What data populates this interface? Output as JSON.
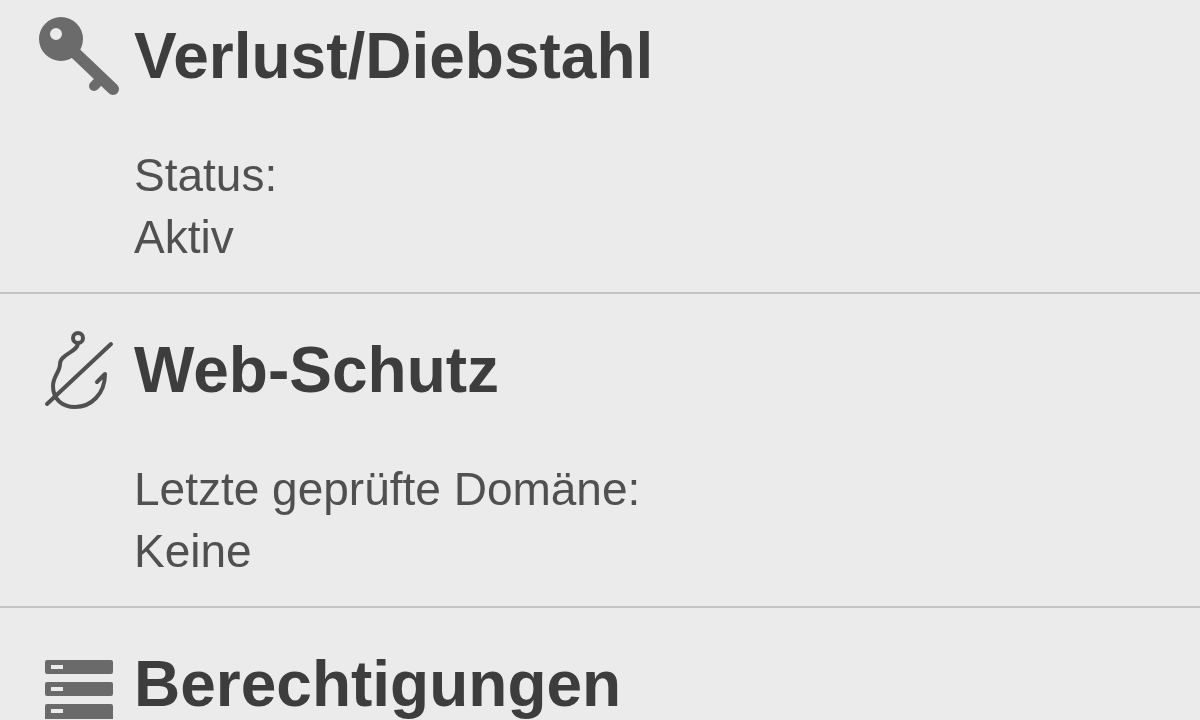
{
  "sections": [
    {
      "kind": "loss",
      "title": "Verlust/Diebstahl",
      "lines": [
        "Status:",
        "Aktiv"
      ]
    },
    {
      "kind": "web",
      "title": "Web-Schutz",
      "lines": [
        "Letzte geprüfte Domäne:",
        "Keine"
      ]
    },
    {
      "kind": "permissions",
      "title": "Berechtigungen"
    }
  ]
}
